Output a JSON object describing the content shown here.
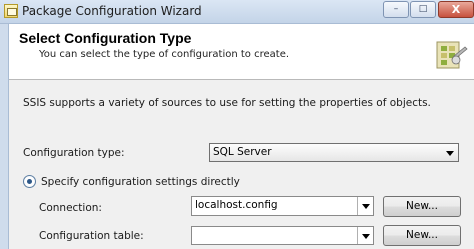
{
  "window": {
    "title": "Package Configuration Wizard",
    "controls": {
      "minimize": "–",
      "maximize": "□",
      "close": "X"
    }
  },
  "header": {
    "title": "Select Configuration Type",
    "subtitle": "You can select the type of configuration to create."
  },
  "intro_text": "SSIS supports a variety of sources to use for setting the properties of objects.",
  "configuration_type": {
    "label": "Configuration type:",
    "value": "SQL Server"
  },
  "specify_option": {
    "label": "Specify configuration settings directly",
    "selected": true
  },
  "connection": {
    "label": "Connection:",
    "value": "localhost.config",
    "new_button": "New..."
  },
  "configuration_table": {
    "label": "Configuration table:",
    "value": "",
    "new_button": "New..."
  },
  "colors": {
    "title_bar": "#c4d4e8",
    "dialog_bg": "#f0f0f0",
    "header_bg": "#ffffff",
    "radio_dot": "#2c5788"
  }
}
